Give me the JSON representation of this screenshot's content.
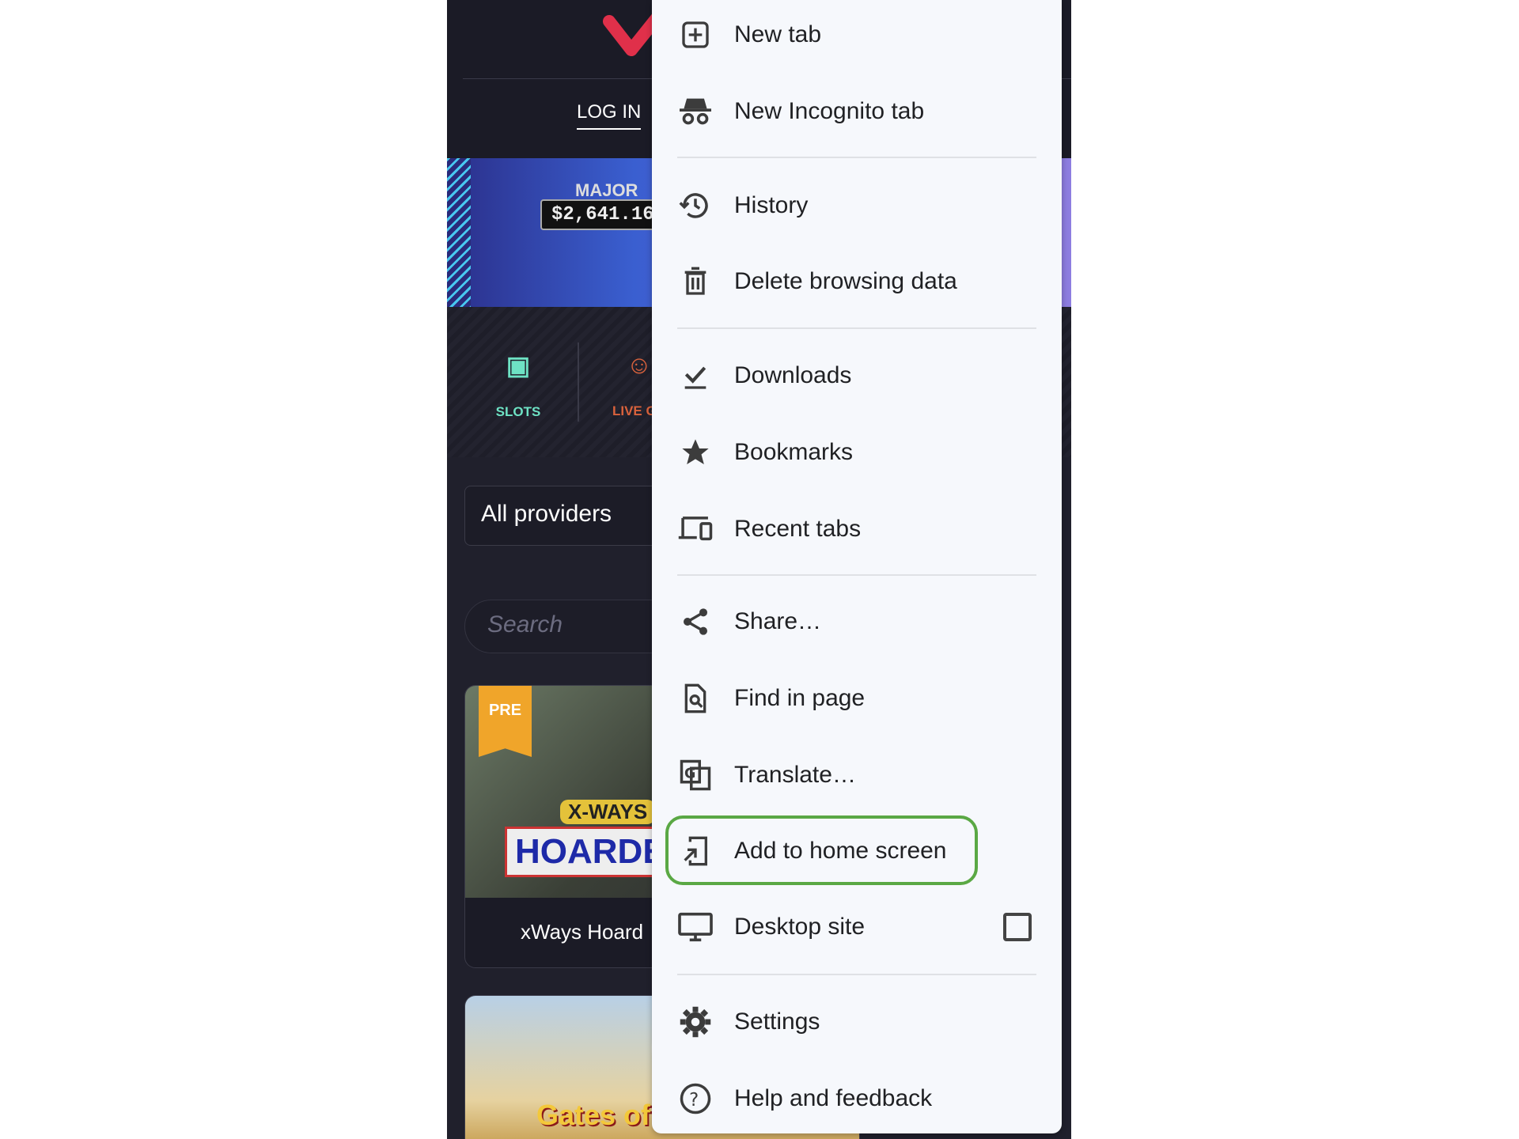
{
  "site": {
    "login": "LOG IN",
    "banner": {
      "label": "MAJOR",
      "amount": "$2,641.16"
    },
    "categories": [
      {
        "label": "SLOTS",
        "icon": "slot-777-icon"
      },
      {
        "label": "LIVE GA",
        "icon": "live-dealer-icon"
      }
    ],
    "providers": "All providers",
    "search_placeholder": "Search",
    "games": [
      {
        "badge": "PRE",
        "title_art": "X-WAYS HOARDE",
        "name": "xWays Hoard"
      },
      {
        "title_art": "Gates of OLYMPU"
      }
    ],
    "colors": {
      "logo": "#e0304a",
      "slots": "#6ee2c4",
      "live": "#d9623c"
    }
  },
  "menu": {
    "items": [
      {
        "label": "New tab",
        "icon": "new-tab-icon"
      },
      {
        "label": "New Incognito tab",
        "icon": "incognito-icon"
      },
      {
        "label": "History",
        "icon": "history-icon"
      },
      {
        "label": "Delete browsing data",
        "icon": "trash-icon"
      },
      {
        "label": "Downloads",
        "icon": "download-icon"
      },
      {
        "label": "Bookmarks",
        "icon": "star-icon"
      },
      {
        "label": "Recent tabs",
        "icon": "devices-icon"
      },
      {
        "label": "Share…",
        "icon": "share-icon"
      },
      {
        "label": "Find in page",
        "icon": "find-in-page-icon"
      },
      {
        "label": "Translate…",
        "icon": "translate-icon"
      },
      {
        "label": "Add to home screen",
        "icon": "add-to-home-icon"
      },
      {
        "label": "Desktop site",
        "icon": "desktop-icon",
        "checked": false
      },
      {
        "label": "Settings",
        "icon": "gear-icon"
      },
      {
        "label": "Help and feedback",
        "icon": "help-icon"
      }
    ],
    "highlighted": "Add to home screen",
    "highlight_color": "#5aa844"
  }
}
